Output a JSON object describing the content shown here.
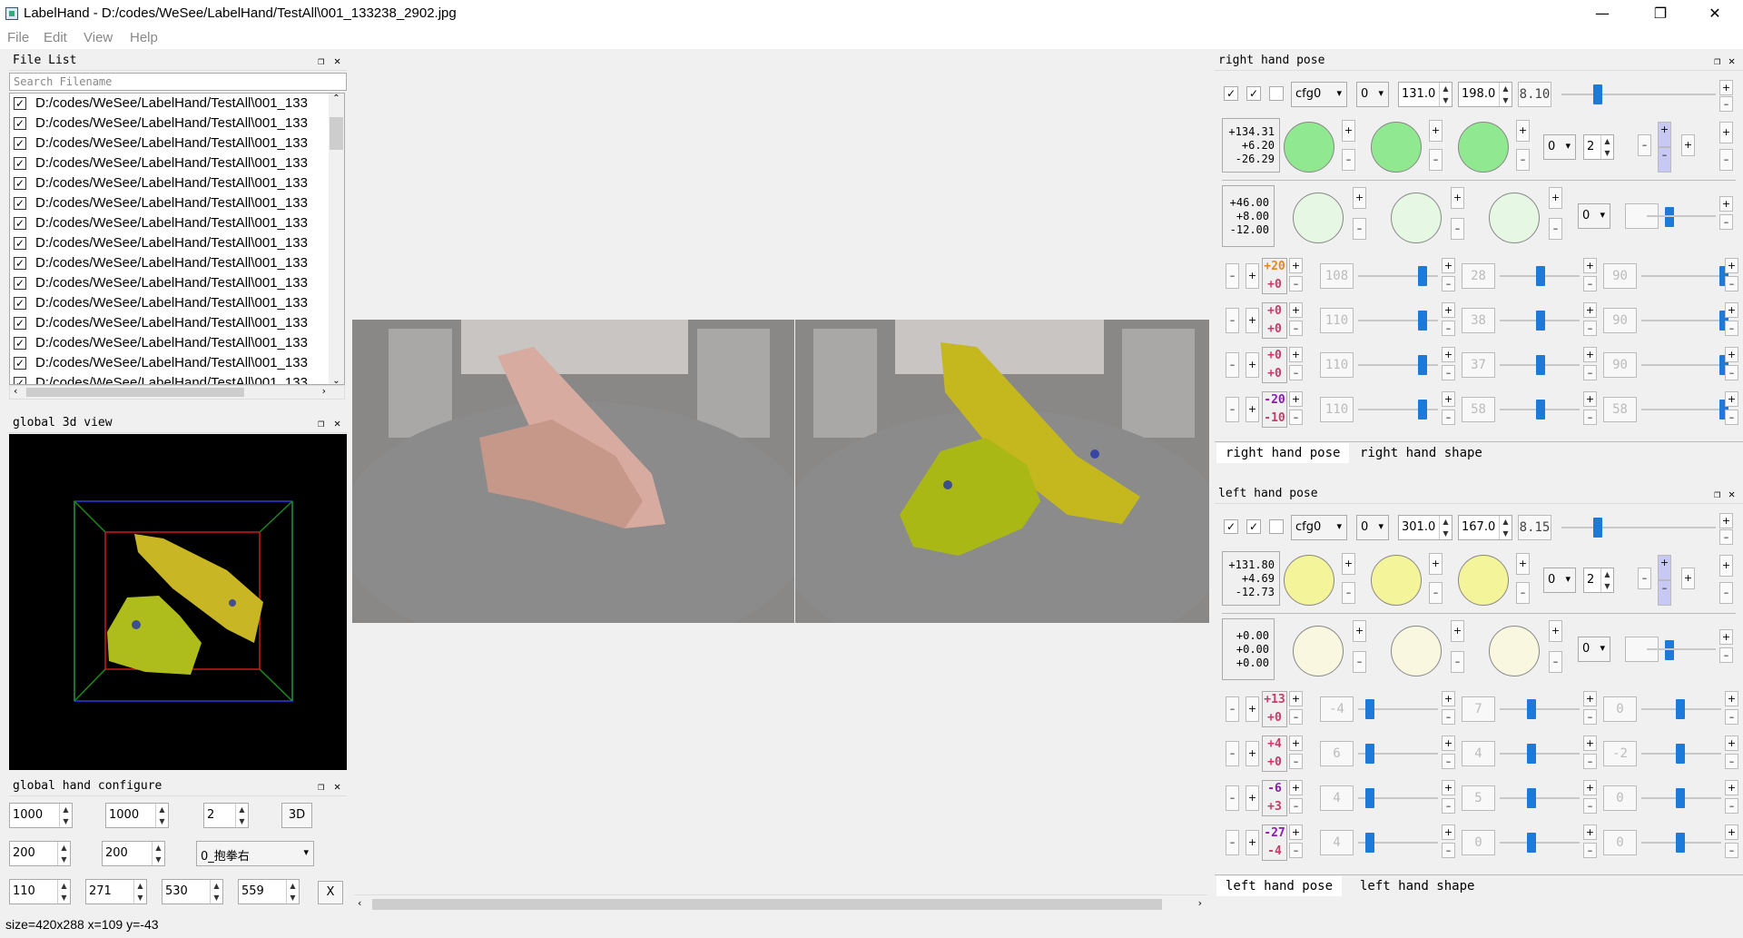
{
  "window": {
    "title": "LabelHand - D:/codes/WeSee/LabelHand/TestAll\\001_133238_2902.jpg",
    "min": "—",
    "max": "❐",
    "close": "✕"
  },
  "menu": [
    "File",
    "Edit",
    "View",
    "Help"
  ],
  "file_list": {
    "header": "File List",
    "search_placeholder": "Search Filename",
    "items": [
      "D:/codes/WeSee/LabelHand/TestAll\\001_133",
      "D:/codes/WeSee/LabelHand/TestAll\\001_133",
      "D:/codes/WeSee/LabelHand/TestAll\\001_133",
      "D:/codes/WeSee/LabelHand/TestAll\\001_133",
      "D:/codes/WeSee/LabelHand/TestAll\\001_133",
      "D:/codes/WeSee/LabelHand/TestAll\\001_133",
      "D:/codes/WeSee/LabelHand/TestAll\\001_133",
      "D:/codes/WeSee/LabelHand/TestAll\\001_133",
      "D:/codes/WeSee/LabelHand/TestAll\\001_133",
      "D:/codes/WeSee/LabelHand/TestAll\\001_133",
      "D:/codes/WeSee/LabelHand/TestAll\\001_133",
      "D:/codes/WeSee/LabelHand/TestAll\\001_133",
      "D:/codes/WeSee/LabelHand/TestAll\\001_133",
      "D:/codes/WeSee/LabelHand/TestAll\\001_133",
      "D:/codes/WeSee/LabelHand/TestAll\\001_133"
    ]
  },
  "global_3d": {
    "header": "global 3d view"
  },
  "global_cfg": {
    "header": "global hand configure",
    "row1": [
      "1000",
      "1000",
      "2"
    ],
    "btn3d": "3D",
    "row2": [
      "200",
      "200"
    ],
    "combo": "0_抱拳右",
    "row3": [
      "110",
      "271",
      "530",
      "559"
    ],
    "btnx": "X"
  },
  "status": "size=420x288 x=109 y=-43",
  "right": {
    "header": "right hand pose",
    "cfg": "cfg0",
    "idx": "0",
    "v1": "131.0",
    "v2": "198.0",
    "lcd": "8.10",
    "vals1": [
      "+134.31",
      "+6.20",
      "-26.29"
    ],
    "combo2": "0",
    "spin2": "2",
    "vals2": [
      "+46.00",
      "+8.00",
      "-12.00"
    ],
    "combo3": "0",
    "fingers": [
      {
        "a": "+20",
        "b": "+0",
        "l1": "108",
        "l2": "28",
        "l3": "90"
      },
      {
        "a": "+0",
        "b": "+0",
        "l1": "110",
        "l2": "38",
        "l3": "90"
      },
      {
        "a": "+0",
        "b": "+0",
        "l1": "110",
        "l2": "37",
        "l3": "90"
      },
      {
        "a": "-20",
        "b": "-10",
        "l1": "110",
        "l2": "58",
        "l3": "58"
      }
    ],
    "tabs": [
      "right hand pose",
      "right hand shape"
    ],
    "knob_color": "#90e890",
    "knob2_color": "#e6f7e4"
  },
  "left": {
    "header": "left hand pose",
    "cfg": "cfg0",
    "idx": "0",
    "v1": "301.0",
    "v2": "167.0",
    "lcd": "8.15",
    "vals1": [
      "+131.80",
      "+4.69",
      "-12.73"
    ],
    "combo2": "0",
    "spin2": "2",
    "vals2": [
      "+0.00",
      "+0.00",
      "+0.00"
    ],
    "combo3": "0",
    "fingers": [
      {
        "a": "+13",
        "b": "+0",
        "l1": "-4",
        "l2": "7",
        "l3": "0"
      },
      {
        "a": "+4",
        "b": "+0",
        "l1": "6",
        "l2": "4",
        "l3": "-2"
      },
      {
        "a": "-6",
        "b": "+3",
        "l1": "4",
        "l2": "5",
        "l3": "0"
      },
      {
        "a": "-27",
        "b": "-4",
        "l1": "4",
        "l2": "0",
        "l3": "0"
      }
    ],
    "tabs": [
      "left hand pose",
      "left hand shape"
    ],
    "knob_color": "#f4f49a",
    "knob2_color": "#f9f7e0"
  },
  "colors": {
    "accent": "#1e7ad8",
    "green": "#90e890",
    "yellow": "#f4f49a"
  }
}
